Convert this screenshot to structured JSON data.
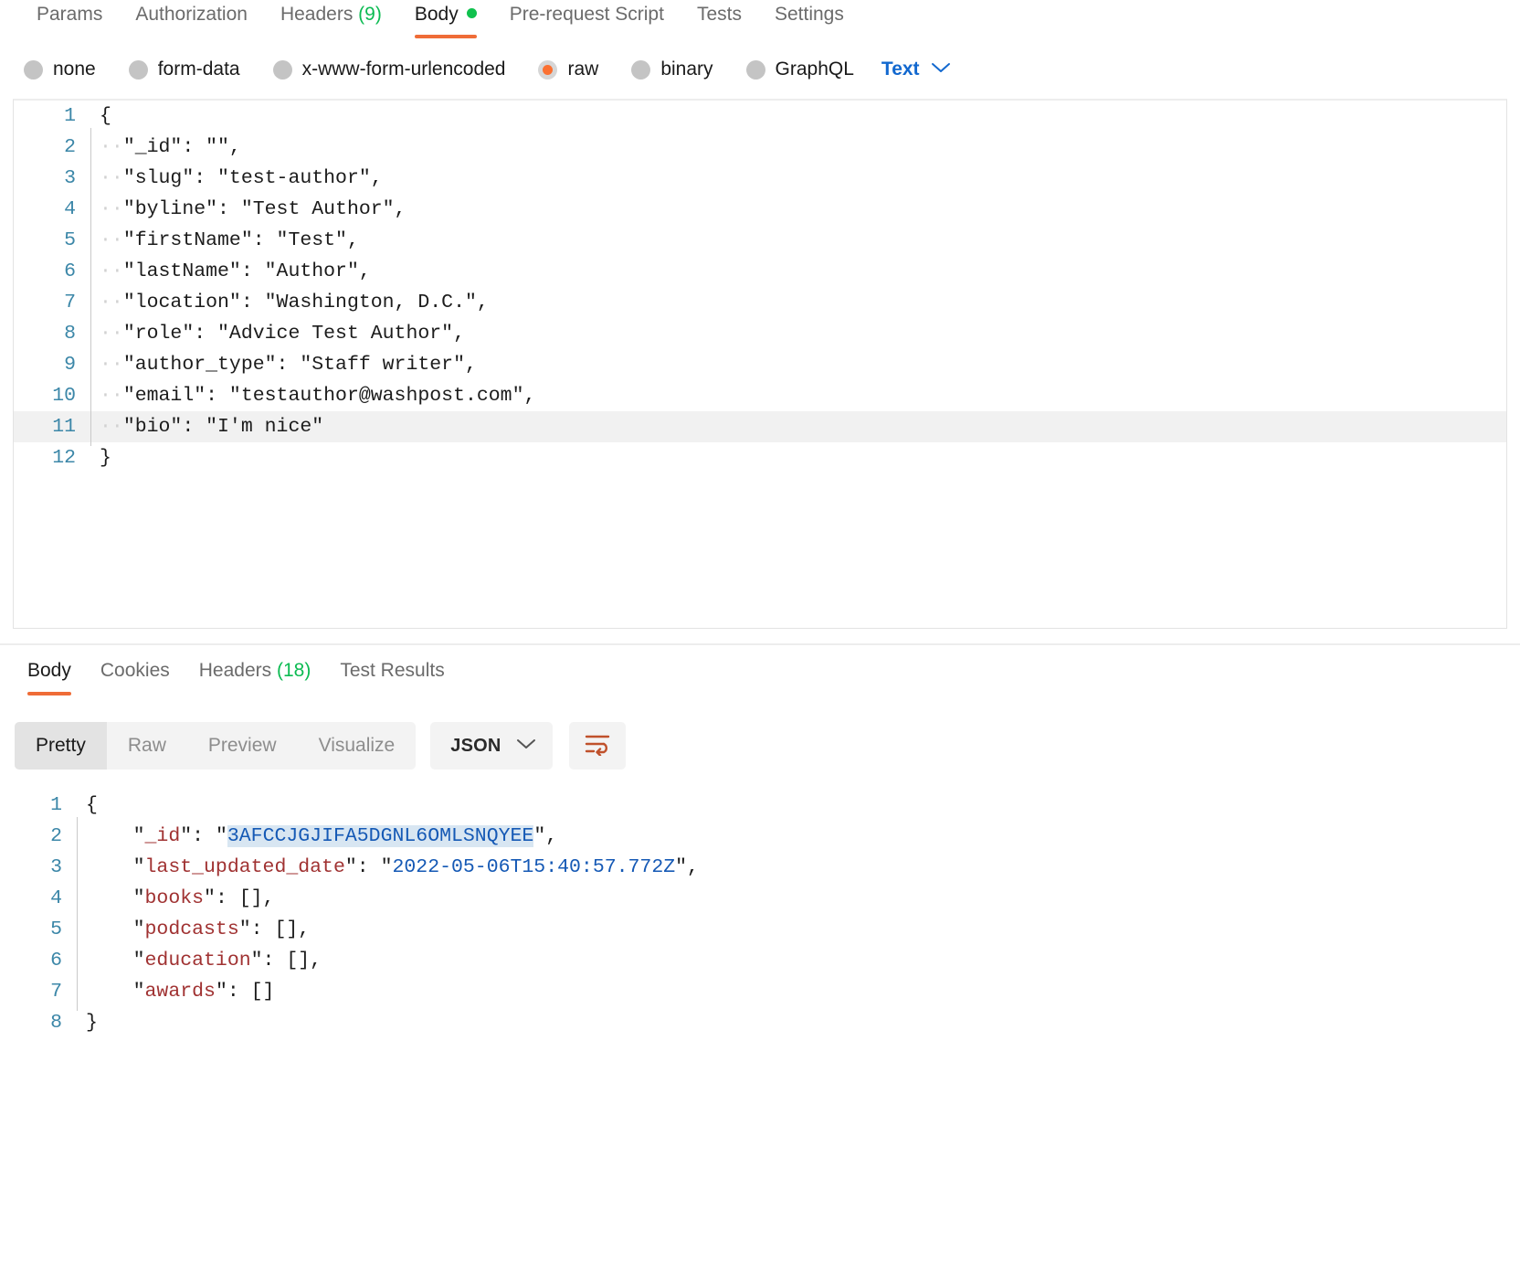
{
  "request": {
    "tabs": [
      {
        "label": "Params",
        "active": false
      },
      {
        "label": "Authorization",
        "active": false
      },
      {
        "label": "Headers",
        "count": "(9)",
        "active": false
      },
      {
        "label": "Body",
        "active": true,
        "dot": true
      },
      {
        "label": "Pre-request Script",
        "active": false
      },
      {
        "label": "Tests",
        "active": false
      },
      {
        "label": "Settings",
        "active": false
      }
    ],
    "body_modes": [
      {
        "label": "none",
        "selected": false
      },
      {
        "label": "form-data",
        "selected": false
      },
      {
        "label": "x-www-form-urlencoded",
        "selected": false
      },
      {
        "label": "raw",
        "selected": true
      },
      {
        "label": "binary",
        "selected": false
      },
      {
        "label": "GraphQL",
        "selected": false
      }
    ],
    "raw_format": "Text",
    "editor_lines": [
      {
        "n": "1",
        "text": "{",
        "indent": false,
        "active": false
      },
      {
        "n": "2",
        "text": "··\"_id\": \"\",",
        "indent": true,
        "active": false
      },
      {
        "n": "3",
        "text": "··\"slug\": \"test-author\",",
        "indent": true,
        "active": false
      },
      {
        "n": "4",
        "text": "··\"byline\": \"Test Author\",",
        "indent": true,
        "active": false
      },
      {
        "n": "5",
        "text": "··\"firstName\": \"Test\",",
        "indent": true,
        "active": false
      },
      {
        "n": "6",
        "text": "··\"lastName\": \"Author\",",
        "indent": true,
        "active": false
      },
      {
        "n": "7",
        "text": "··\"location\": \"Washington, D.C.\",",
        "indent": true,
        "active": false
      },
      {
        "n": "8",
        "text": "··\"role\": \"Advice Test Author\",",
        "indent": true,
        "active": false
      },
      {
        "n": "9",
        "text": "··\"author_type\": \"Staff writer\",",
        "indent": true,
        "active": false
      },
      {
        "n": "10",
        "text": "··\"email\": \"testauthor@washpost.com\",",
        "indent": true,
        "active": false
      },
      {
        "n": "11",
        "text": "··\"bio\": \"I'm nice\"",
        "indent": true,
        "active": true
      },
      {
        "n": "12",
        "text": "}",
        "indent": false,
        "active": false
      }
    ]
  },
  "response": {
    "tabs": [
      {
        "label": "Body",
        "active": true
      },
      {
        "label": "Cookies",
        "active": false
      },
      {
        "label": "Headers",
        "count": "(18)",
        "active": false
      },
      {
        "label": "Test Results",
        "active": false
      }
    ],
    "view_modes": [
      {
        "label": "Pretty",
        "active": true
      },
      {
        "label": "Raw",
        "active": false
      },
      {
        "label": "Preview",
        "active": false
      },
      {
        "label": "Visualize",
        "active": false
      }
    ],
    "content_type": "JSON",
    "wrap_icon": "word-wrap-icon",
    "body_lines": [
      {
        "n": "1",
        "indent": false,
        "parts": [
          {
            "t": "{",
            "c": "punc"
          }
        ]
      },
      {
        "n": "2",
        "indent": true,
        "parts": [
          {
            "t": "\"",
            "c": "punc"
          },
          {
            "t": "_id",
            "c": "key"
          },
          {
            "t": "\"",
            "c": "punc"
          },
          {
            "t": ": ",
            "c": "punc"
          },
          {
            "t": "\"",
            "c": "punc"
          },
          {
            "t": "3AFCCJGJIFA5DGNL6OMLSNQYEE",
            "c": "str-sel"
          },
          {
            "t": "\"",
            "c": "punc"
          },
          {
            "t": ",",
            "c": "punc"
          }
        ]
      },
      {
        "n": "3",
        "indent": true,
        "parts": [
          {
            "t": "\"",
            "c": "punc"
          },
          {
            "t": "last_updated_date",
            "c": "key"
          },
          {
            "t": "\"",
            "c": "punc"
          },
          {
            "t": ": ",
            "c": "punc"
          },
          {
            "t": "\"",
            "c": "punc"
          },
          {
            "t": "2022-05-06T15:40:57.772Z",
            "c": "str"
          },
          {
            "t": "\"",
            "c": "punc"
          },
          {
            "t": ",",
            "c": "punc"
          }
        ]
      },
      {
        "n": "4",
        "indent": true,
        "parts": [
          {
            "t": "\"",
            "c": "punc"
          },
          {
            "t": "books",
            "c": "key"
          },
          {
            "t": "\"",
            "c": "punc"
          },
          {
            "t": ": [],",
            "c": "punc"
          }
        ]
      },
      {
        "n": "5",
        "indent": true,
        "parts": [
          {
            "t": "\"",
            "c": "punc"
          },
          {
            "t": "podcasts",
            "c": "key"
          },
          {
            "t": "\"",
            "c": "punc"
          },
          {
            "t": ": [],",
            "c": "punc"
          }
        ]
      },
      {
        "n": "6",
        "indent": true,
        "parts": [
          {
            "t": "\"",
            "c": "punc"
          },
          {
            "t": "education",
            "c": "key"
          },
          {
            "t": "\"",
            "c": "punc"
          },
          {
            "t": ": [],",
            "c": "punc"
          }
        ]
      },
      {
        "n": "7",
        "indent": true,
        "parts": [
          {
            "t": "\"",
            "c": "punc"
          },
          {
            "t": "awards",
            "c": "key"
          },
          {
            "t": "\"",
            "c": "punc"
          },
          {
            "t": ": []",
            "c": "punc"
          }
        ]
      },
      {
        "n": "8",
        "indent": false,
        "parts": [
          {
            "t": "}",
            "c": "punc"
          }
        ]
      }
    ]
  },
  "colors": {
    "accent": "#ef6c37",
    "link": "#1268cf",
    "status_dot": "#10c14e",
    "count_green": "#0cbb52",
    "json_key": "#a03232",
    "json_string": "#1559b5",
    "selection": "#d8e6f2"
  }
}
